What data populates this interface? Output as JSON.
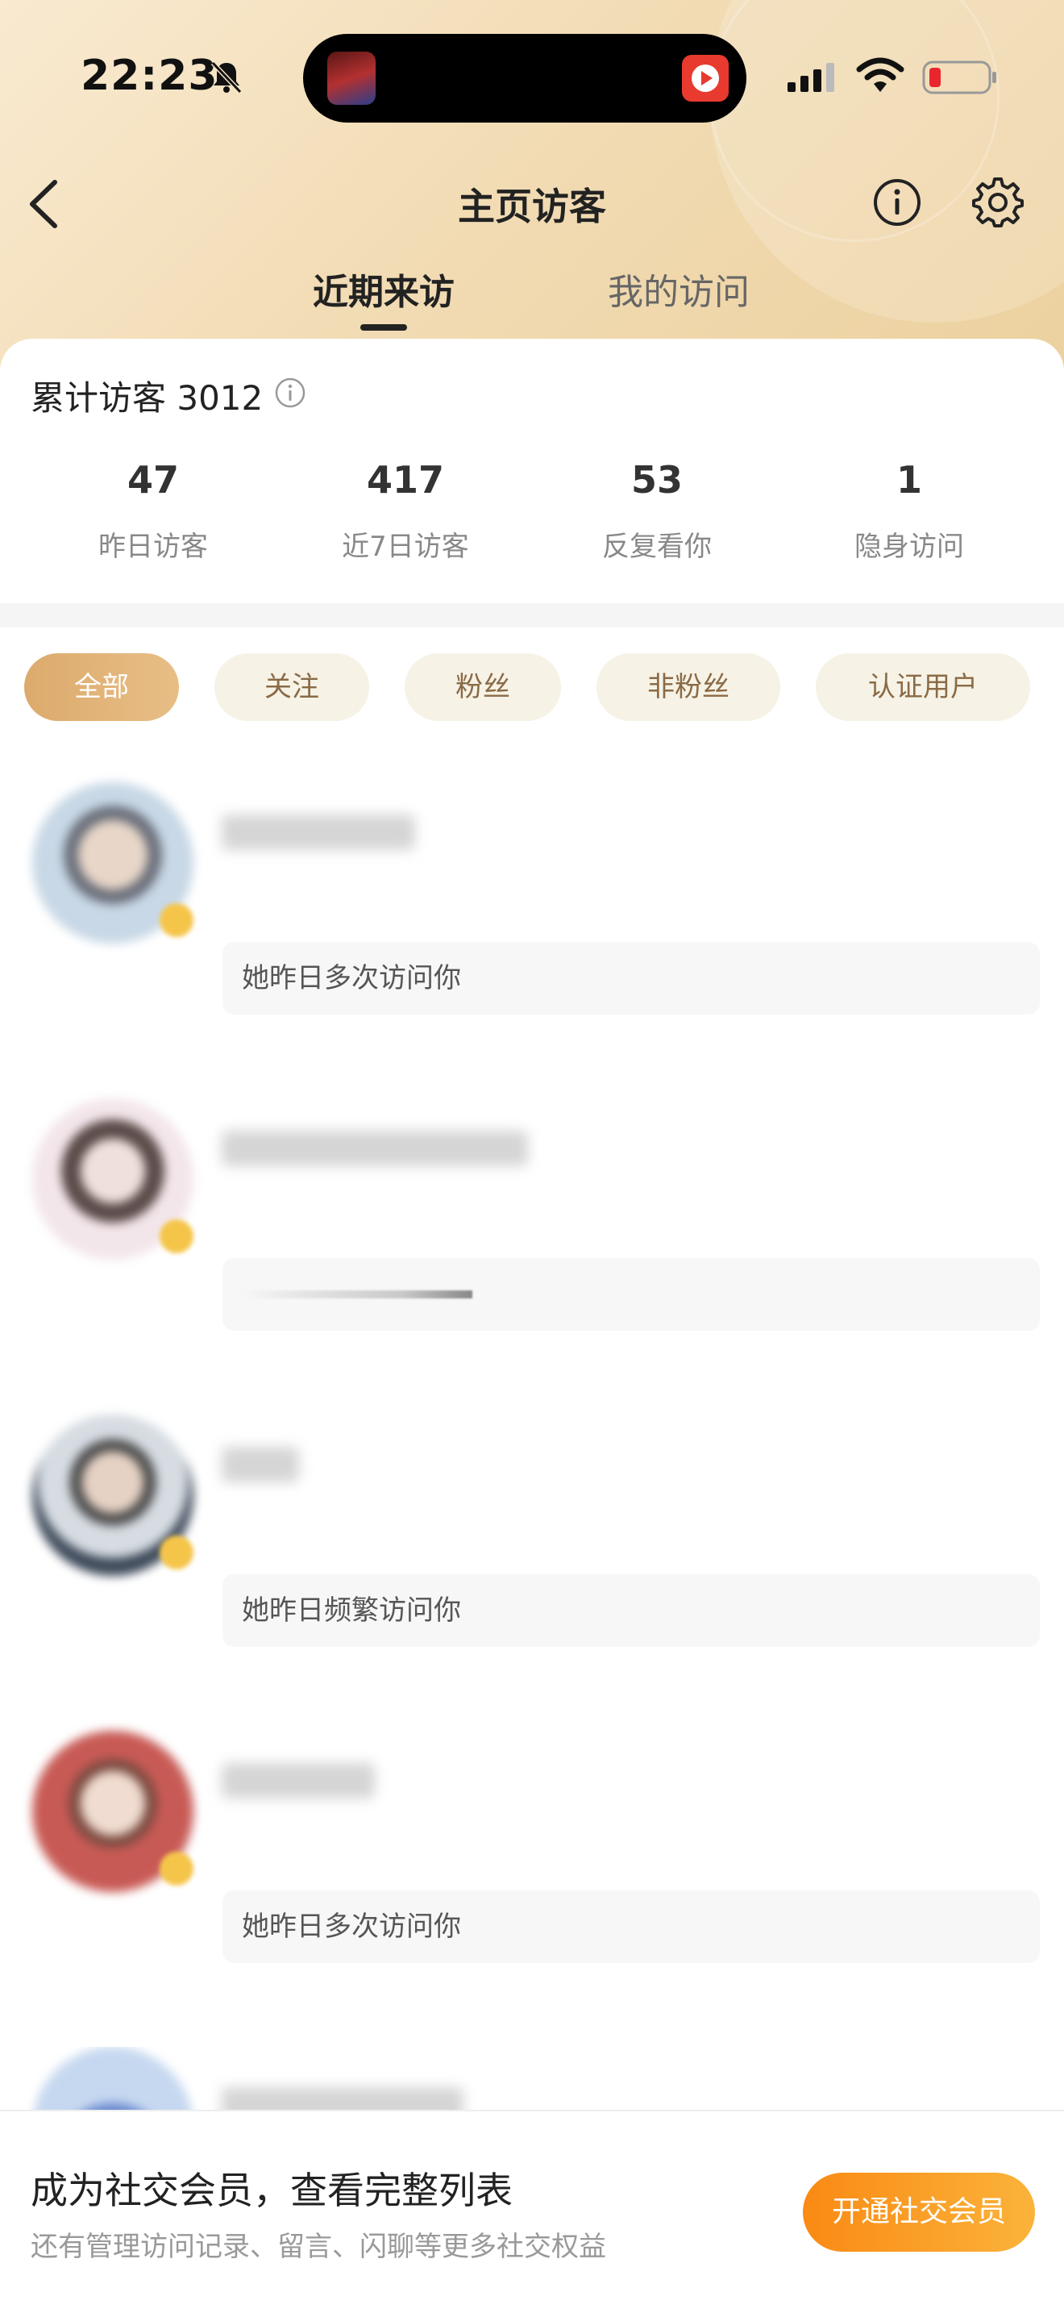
{
  "status_bar": {
    "time": "22:23",
    "icons": [
      "bell-slash-icon",
      "signal-icon",
      "wifi-icon",
      "battery-low-icon"
    ]
  },
  "header": {
    "title": "主页访客",
    "back_icon": "chevron-left-icon",
    "info_icon": "info-circle-icon",
    "settings_icon": "gear-icon"
  },
  "tabs": [
    {
      "label": "近期来访",
      "active": true
    },
    {
      "label": "我的访问",
      "active": false
    }
  ],
  "summary": {
    "total_label": "累计访客 3012",
    "stats": [
      {
        "value": "47",
        "label": "昨日访客"
      },
      {
        "value": "417",
        "label": "近7日访客"
      },
      {
        "value": "53",
        "label": "反复看你"
      },
      {
        "value": "1",
        "label": "隐身访问"
      }
    ]
  },
  "filters": [
    {
      "label": "全部",
      "active": true
    },
    {
      "label": "关注",
      "active": false
    },
    {
      "label": "粉丝",
      "active": false
    },
    {
      "label": "非粉丝",
      "active": false
    },
    {
      "label": "认证用户",
      "active": false
    }
  ],
  "visitors": [
    {
      "note": "她昨日多次访问你"
    },
    {
      "note": ""
    },
    {
      "note": "她昨日频繁访问你"
    },
    {
      "note": "她昨日多次访问你"
    }
  ],
  "banner": {
    "title": "成为社交会员，查看完整列表",
    "subtitle": "还有管理访问记录、留言、闪聊等更多社交权益",
    "button": "开通社交会员"
  },
  "colors": {
    "accent_gold": "#dcaa6c",
    "cta_orange": "#fa8a14",
    "hero_bg": "#f2dcb5"
  }
}
